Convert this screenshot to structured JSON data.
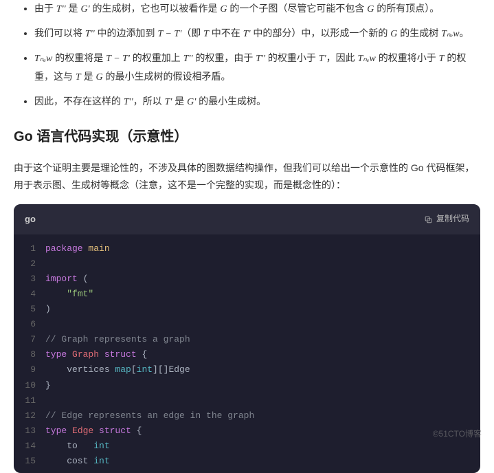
{
  "bullets": [
    {
      "pre": "由于 ",
      "m1": "T''",
      "mid1": " 是 ",
      "m2": "G'",
      "mid2": " 的生成树，它也可以被看作是 ",
      "m3": "G",
      "mid3": " 的一个子图（尽管它可能不包含 ",
      "m4": "G",
      "tail": " 的所有顶点）。"
    },
    {
      "pre": "我们可以将 ",
      "m1": "T''",
      "mid1": " 中的边添加到 ",
      "m2": "T − T'",
      "mid2": "（即 ",
      "m3": "T",
      "mid3": " 中不在 ",
      "m4": "T'",
      "mid4": " 中的部分）中，以形成一个新的 ",
      "m5": "G",
      "mid5": " 的生成树 ",
      "m6": "Tₙₑw",
      "tail": "。"
    },
    {
      "pre": "",
      "m1": "Tₙₑw",
      "mid1": " 的权重将是 ",
      "m2": "T − T'",
      "mid2": " 的权重加上 ",
      "m3": "T''",
      "mid3": " 的权重，由于 ",
      "m4": "T''",
      "mid4": " 的权重小于 ",
      "m5": "T'",
      "mid5": "，因此 ",
      "m6": "Tₙₑw",
      "mid6": " 的权重将小于 ",
      "m7": "T",
      "mid7": " 的权重，这与 ",
      "m8": "T",
      "mid8": " 是 ",
      "m9": "G",
      "tail": " 的最小生成树的假设相矛盾。"
    },
    {
      "pre": "因此，不存在这样的 ",
      "m1": "T''",
      "mid1": "，所以 ",
      "m2": "T'",
      "mid2": " 是 ",
      "m3": "G'",
      "tail": " 的最小生成树。"
    }
  ],
  "section_heading": "Go 语言代码实现（示意性）",
  "lead_paragraph": "由于这个证明主要是理论性的，不涉及具体的图数据结构操作，但我们可以给出一个示意性的 Go 代码框架，用于表示图、生成树等概念（注意，这不是一个完整的实现，而是概念性的）：",
  "code": {
    "lang": "go",
    "copy_label": "复制代码",
    "lines": [
      [
        {
          "t": "package ",
          "c": "tok-kw"
        },
        {
          "t": "main",
          "c": "tok-pkg"
        }
      ],
      [],
      [
        {
          "t": "import ",
          "c": "tok-kw"
        },
        {
          "t": "(",
          "c": "tok-b"
        }
      ],
      [
        {
          "t": "    ",
          "c": ""
        },
        {
          "t": "\"fmt\"",
          "c": "tok-str"
        }
      ],
      [
        {
          "t": ")",
          "c": "tok-b"
        }
      ],
      [],
      [
        {
          "t": "// Graph represents a graph",
          "c": "tok-cm"
        }
      ],
      [
        {
          "t": "type ",
          "c": "tok-kw"
        },
        {
          "t": "Graph ",
          "c": "tok-id"
        },
        {
          "t": "struct ",
          "c": "tok-kw"
        },
        {
          "t": "{",
          "c": "tok-b"
        }
      ],
      [
        {
          "t": "    vertices ",
          "c": "tok-b"
        },
        {
          "t": "map",
          "c": "tok-type"
        },
        {
          "t": "[",
          "c": "tok-b"
        },
        {
          "t": "int",
          "c": "tok-type"
        },
        {
          "t": "][]Edge",
          "c": "tok-b"
        }
      ],
      [
        {
          "t": "}",
          "c": "tok-b"
        }
      ],
      [],
      [
        {
          "t": "// Edge represents an edge in the graph",
          "c": "tok-cm"
        }
      ],
      [
        {
          "t": "type ",
          "c": "tok-kw"
        },
        {
          "t": "Edge ",
          "c": "tok-id"
        },
        {
          "t": "struct ",
          "c": "tok-kw"
        },
        {
          "t": "{",
          "c": "tok-b"
        }
      ],
      [
        {
          "t": "    to   ",
          "c": "tok-b"
        },
        {
          "t": "int",
          "c": "tok-type"
        }
      ],
      [
        {
          "t": "    cost ",
          "c": "tok-b"
        },
        {
          "t": "int",
          "c": "tok-type"
        }
      ]
    ]
  },
  "watermark": "©51CTO博客"
}
